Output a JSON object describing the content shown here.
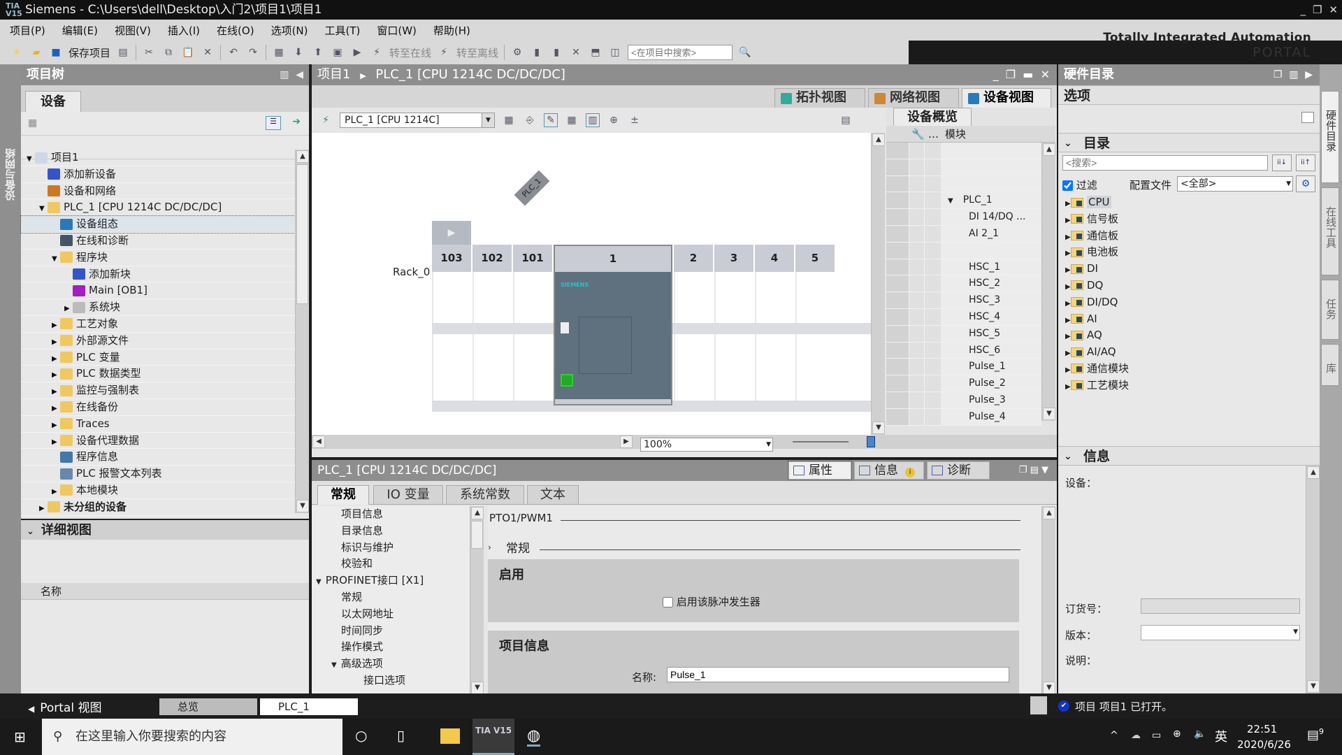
{
  "window": {
    "app": "Siemens",
    "path": "C:\\Users\\dell\\Desktop\\入门2\\项目1\\项目1",
    "title": "Siemens  -  C:\\Users\\dell\\Desktop\\入门2\\项目1\\项目1"
  },
  "menu": [
    "项目(P)",
    "编辑(E)",
    "视图(V)",
    "插入(I)",
    "在线(O)",
    "选项(N)",
    "工具(T)",
    "窗口(W)",
    "帮助(H)"
  ],
  "brand": {
    "line1": "Totally Integrated Automation",
    "line2": "PORTAL"
  },
  "toolbar": {
    "save_label": "保存项目",
    "go_online": "转至在线",
    "go_offline": "转至离线",
    "search_placeholder": "<在项目中搜索>"
  },
  "left_vertical_tab": "设备与网络",
  "project_tree": {
    "title": "项目树",
    "tab": "设备",
    "items": [
      {
        "label": "项目1",
        "level": 0,
        "arrow": "▼"
      },
      {
        "label": "添加新设备",
        "level": 1,
        "arrow": ""
      },
      {
        "label": "设备和网络",
        "level": 1,
        "arrow": ""
      },
      {
        "label": "PLC_1 [CPU 1214C DC/DC/DC]",
        "level": 1,
        "arrow": "▼"
      },
      {
        "label": "设备组态",
        "level": 2,
        "arrow": "",
        "selected": true
      },
      {
        "label": "在线和诊断",
        "level": 2,
        "arrow": ""
      },
      {
        "label": "程序块",
        "level": 2,
        "arrow": "▼"
      },
      {
        "label": "添加新块",
        "level": 3,
        "arrow": ""
      },
      {
        "label": "Main [OB1]",
        "level": 3,
        "arrow": ""
      },
      {
        "label": "系统块",
        "level": 3,
        "arrow": "▶"
      },
      {
        "label": "工艺对象",
        "level": 2,
        "arrow": "▶"
      },
      {
        "label": "外部源文件",
        "level": 2,
        "arrow": "▶"
      },
      {
        "label": "PLC 变量",
        "level": 2,
        "arrow": "▶"
      },
      {
        "label": "PLC 数据类型",
        "level": 2,
        "arrow": "▶"
      },
      {
        "label": "监控与强制表",
        "level": 2,
        "arrow": "▶"
      },
      {
        "label": "在线备份",
        "level": 2,
        "arrow": "▶"
      },
      {
        "label": "Traces",
        "level": 2,
        "arrow": "▶"
      },
      {
        "label": "设备代理数据",
        "level": 2,
        "arrow": "▶"
      },
      {
        "label": "程序信息",
        "level": 2,
        "arrow": ""
      },
      {
        "label": "PLC 报警文本列表",
        "level": 2,
        "arrow": ""
      },
      {
        "label": "本地模块",
        "level": 2,
        "arrow": "▶"
      },
      {
        "label": "未分组的设备",
        "level": 1,
        "arrow": "▶"
      }
    ]
  },
  "detail_view": {
    "title": "详细视图",
    "column": "名称"
  },
  "editor": {
    "breadcrumb": [
      "项目1",
      "PLC_1 [CPU 1214C DC/DC/DC]"
    ],
    "view_tabs": [
      "拓扑视图",
      "网络视图",
      "设备视图"
    ],
    "active_view": "设备视图",
    "device_select": "PLC_1 [CPU 1214C]",
    "plc_tag": "PLC_1",
    "rack_label": "Rack_0",
    "slots": [
      "103",
      "102",
      "101",
      "1",
      "2",
      "3",
      "4",
      "5"
    ],
    "zoom": "100%",
    "overview": {
      "tab": "设备概览",
      "column": "模块",
      "rows": [
        "",
        "",
        "",
        "PLC_1",
        "DI 14/DQ ...",
        "AI 2_1",
        "",
        "HSC_1",
        "HSC_2",
        "HSC_3",
        "HSC_4",
        "HSC_5",
        "HSC_6",
        "Pulse_1",
        "Pulse_2",
        "Pulse_3",
        "Pulse_4"
      ]
    }
  },
  "properties": {
    "title": "PLC_1 [CPU 1214C DC/DC/DC]",
    "panel_tabs": [
      "属性",
      "信息",
      "诊断"
    ],
    "subtabs": [
      "常规",
      "IO 变量",
      "系统常数",
      "文本"
    ],
    "nav": [
      {
        "label": "项目信息",
        "indent": 1
      },
      {
        "label": "目录信息",
        "indent": 1
      },
      {
        "label": "标识与维护",
        "indent": 1
      },
      {
        "label": "校验和",
        "indent": 1
      },
      {
        "label": "PROFINET接口 [X1]",
        "indent": 0,
        "arrow": "▼"
      },
      {
        "label": "常规",
        "indent": 1
      },
      {
        "label": "以太网地址",
        "indent": 1
      },
      {
        "label": "时间同步",
        "indent": 1
      },
      {
        "label": "操作模式",
        "indent": 1
      },
      {
        "label": "高级选项",
        "indent": 1,
        "arrow": "▼"
      },
      {
        "label": "接口选项",
        "indent": 2
      }
    ],
    "section_title": "PTO1/PWM1",
    "subsection": "常规",
    "enable_group": "启用",
    "enable_checkbox": "启用该脉冲发生器",
    "enable_checked": false,
    "project_info_group": "项目信息",
    "name_label": "名称:",
    "name_value": "Pulse_1"
  },
  "hardware_catalog": {
    "title": "硬件目录",
    "options": "选项",
    "catalog": "目录",
    "search_placeholder": "<搜索>",
    "filter_label": "过滤",
    "filter_checked": true,
    "profile_label": "配置文件",
    "profile_value": "<全部>",
    "categories": [
      "CPU",
      "信号板",
      "通信板",
      "电池板",
      "DI",
      "DQ",
      "DI/DQ",
      "AI",
      "AQ",
      "AI/AQ",
      "通信模块",
      "工艺模块"
    ],
    "info": {
      "title": "信息",
      "device_label": "设备：",
      "order_label": "订货号：",
      "version_label": "版本：",
      "desc_label": "说明："
    }
  },
  "right_tabs": [
    "硬件目录",
    "在线工具",
    "任务",
    "库"
  ],
  "statusbar": {
    "portal_view": "Portal 视图",
    "tabs": [
      "总览",
      "PLC_1"
    ],
    "message": "项目 项目1 已打开。"
  },
  "taskbar": {
    "search_placeholder": "在这里输入你要搜索的内容",
    "tia_label": "TIA V15",
    "ime": "英",
    "time": "22:51",
    "date": "2020/6/26",
    "notifications": "9"
  }
}
